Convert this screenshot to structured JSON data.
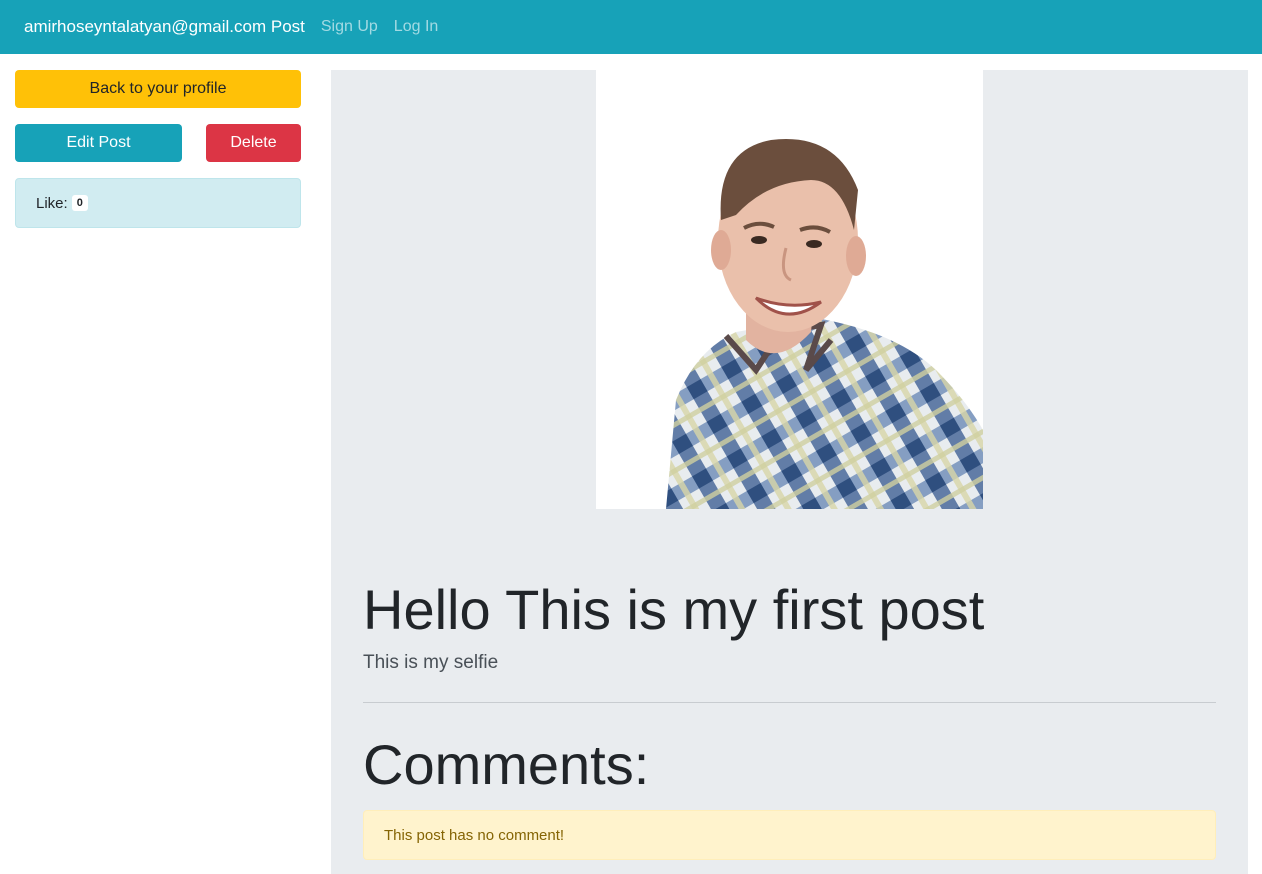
{
  "navbar": {
    "brand": "amirhoseyntalatyan@gmail.com Post",
    "links": [
      "Sign Up",
      "Log In"
    ],
    "bg_color": "#17a2b8"
  },
  "sidebar": {
    "back_label": "Back to your profile",
    "edit_label": "Edit Post",
    "delete_label": "Delete",
    "like_label": "Like:",
    "like_count": "0"
  },
  "post": {
    "image_alt": "selfie-photo",
    "title": "Hello This is my first post",
    "body": "This is my selfie"
  },
  "comments": {
    "heading": "Comments:",
    "empty_message": "This post has no comment!"
  },
  "colors": {
    "accent": "#17a2b8",
    "warning": "#ffc107",
    "danger": "#dc3545",
    "info_bg": "#d1ecf1",
    "alert_bg": "#fff3cd"
  }
}
